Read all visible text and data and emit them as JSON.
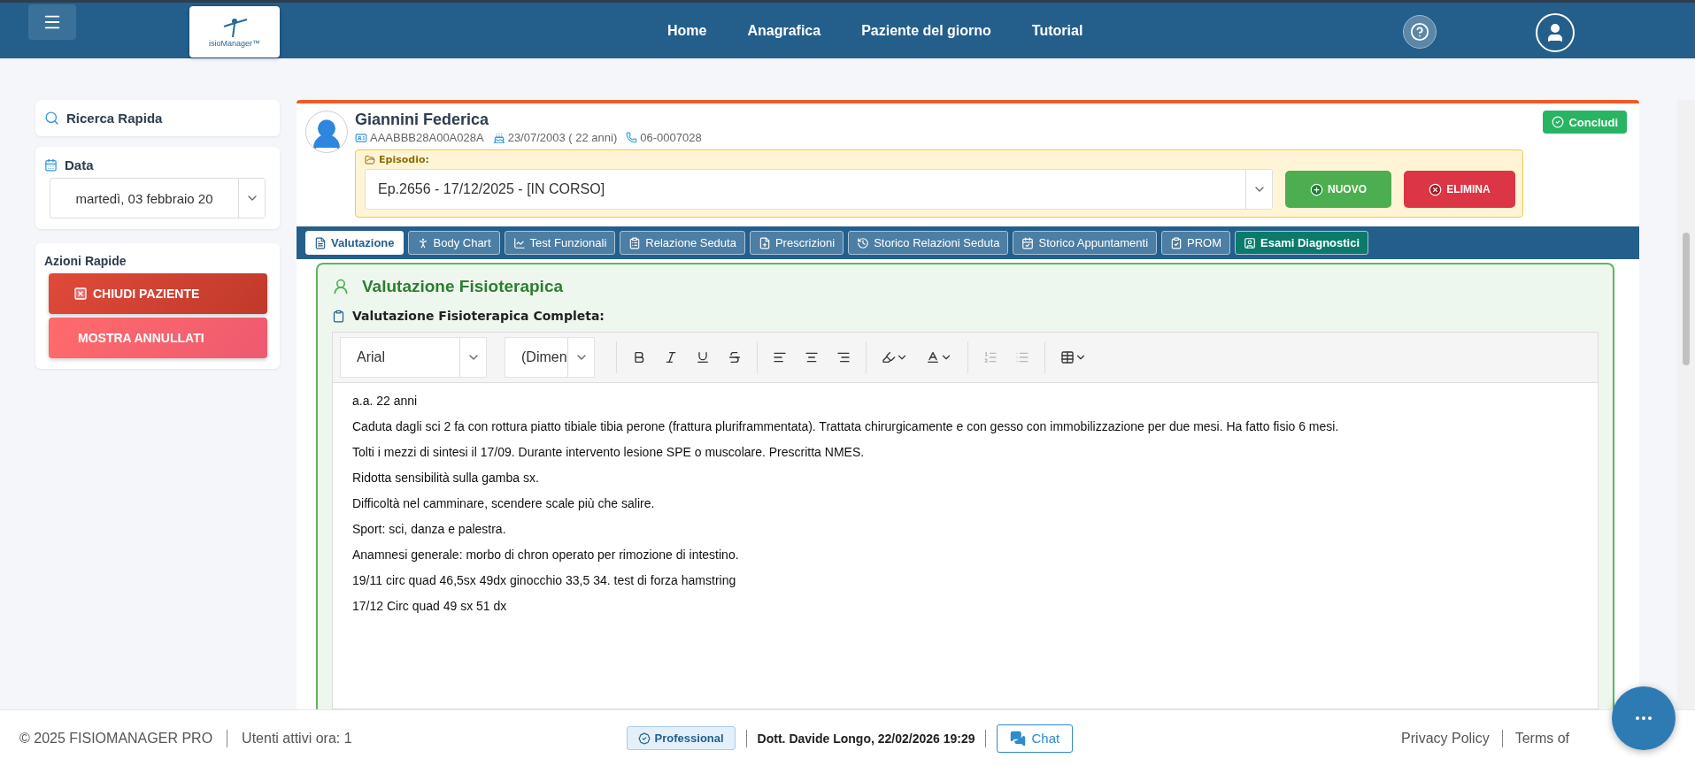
{
  "nav": {
    "links": [
      "Home",
      "Anagrafica",
      "Paziente del giorno",
      "Tutorial"
    ],
    "logo_text": "isioManager™"
  },
  "sidebar": {
    "search_label": "Ricerca Rapida",
    "date_label": "Data",
    "date_value": "martedì, 03 febbraio 20",
    "actions_title": "Azioni Rapide",
    "actions": [
      {
        "label": "CHIUDI PAZIENTE",
        "kind": "danger"
      },
      {
        "label": "MOSTRA ANNULLATI",
        "kind": "soft"
      }
    ]
  },
  "patient": {
    "name": "Giannini Federica",
    "code": "AAABBB28A00A028A",
    "birth": "23/07/2003 ( 22 anni)",
    "phone": "06-0007028",
    "conclude": "Concludi"
  },
  "episode": {
    "label": "Episodio:",
    "value": "Ep.2656 - 17/12/2025 - [IN CORSO]",
    "new_button": "NUOVO",
    "delete_button": "ELIMINA"
  },
  "tabs": [
    {
      "label": "Valutazione",
      "selected": true,
      "kind": "normal"
    },
    {
      "label": "Body Chart",
      "selected": false,
      "kind": "normal"
    },
    {
      "label": "Test Funzionali",
      "selected": false,
      "kind": "normal"
    },
    {
      "label": "Relazione Seduta",
      "selected": false,
      "kind": "normal"
    },
    {
      "label": "Prescrizioni",
      "selected": false,
      "kind": "normal"
    },
    {
      "label": "Storico Relazioni Seduta",
      "selected": false,
      "kind": "normal"
    },
    {
      "label": "Storico Appuntamenti",
      "selected": false,
      "kind": "normal"
    },
    {
      "label": "PROM",
      "selected": false,
      "kind": "normal"
    },
    {
      "label": "Esami Diagnostici",
      "selected": false,
      "kind": "accent"
    }
  ],
  "panel": {
    "title": "Valutazione Fisioterapica",
    "subtitle": "Valutazione Fisioterapica Completa:"
  },
  "editor": {
    "font": "Arial",
    "size": "(Dimen",
    "lines": [
      "a.a. 22 anni",
      "Caduta dagli sci 2 fa con rottura piatto tibiale tibia perone (frattura pluriframmentata). Trattata chirurgicamente e con gesso con immobilizzazione per due mesi. Ha fatto fisio 6 mesi.",
      "Tolti i mezzi di sintesi il 17/09. Durante intervento lesione SPE o muscolare. Prescritta NMES.",
      "Ridotta sensibilità sulla gamba sx.",
      "Difficoltà nel camminare, scendere scale più che salire.",
      "Sport: sci, danza e palestra.",
      "Anamnesi generale: morbo di chron operato per rimozione di intestino.",
      "19/11 circ quad 46,5sx 49dx ginocchio 33,5 34. test di forza hamstring",
      "17/12 Circ quad 49 sx 51 dx"
    ]
  },
  "footer": {
    "copyright": "© 2025 FISIOMANAGER PRO",
    "users": "Utenti attivi ora: 1",
    "plan": "Professional",
    "user": "Dott. Davide Longo, 22/02/2026 19:29",
    "chat": "Chat",
    "links": [
      "Privacy Policy",
      "Terms of"
    ]
  }
}
